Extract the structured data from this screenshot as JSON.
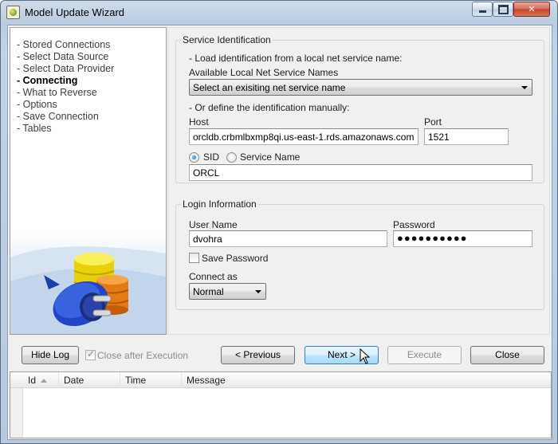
{
  "window": {
    "title": "Model Update Wizard",
    "close_symbol": "✕"
  },
  "nav": {
    "items": [
      {
        "label": "- Stored Connections",
        "active": false
      },
      {
        "label": "- Select Data Source",
        "active": false
      },
      {
        "label": "- Select Data Provider",
        "active": false
      },
      {
        "label": "- Connecting",
        "active": true
      },
      {
        "label": "- What to Reverse",
        "active": false
      },
      {
        "label": "- Options",
        "active": false
      },
      {
        "label": "- Save Connection",
        "active": false
      },
      {
        "label": "- Tables",
        "active": false
      }
    ]
  },
  "service": {
    "group_title": "Service Identification",
    "load_text": "- Load identification from a local net service name:",
    "available_label": "Available Local Net Service Names",
    "service_combo_value": "Select an exisiting net service name",
    "manual_text": "- Or define the identification manually:",
    "host_label": "Host",
    "host_value": "orcldb.crbmlbxmp8qi.us-east-1.rds.amazonaws.com",
    "port_label": "Port",
    "port_value": "1521",
    "sid_label": "SID",
    "service_name_label": "Service Name",
    "sid_selected": true,
    "sid_value": "ORCL"
  },
  "login": {
    "group_title": "Login Information",
    "username_label": "User Name",
    "username_value": "dvohra",
    "password_label": "Password",
    "password_mask": "●●●●●●●●●●",
    "save_password_label": "Save Password",
    "save_password_checked": false,
    "connect_as_label": "Connect as",
    "connect_as_value": "Normal"
  },
  "buttons": {
    "hide_log": "Hide Log",
    "close_after_execution": "Close after Execution",
    "close_after_execution_checked": true,
    "previous": "< Previous",
    "next": "Next >",
    "execute": "Execute",
    "close": "Close"
  },
  "log": {
    "columns": [
      "Id",
      "Date",
      "Time",
      "Message"
    ],
    "rows": []
  }
}
